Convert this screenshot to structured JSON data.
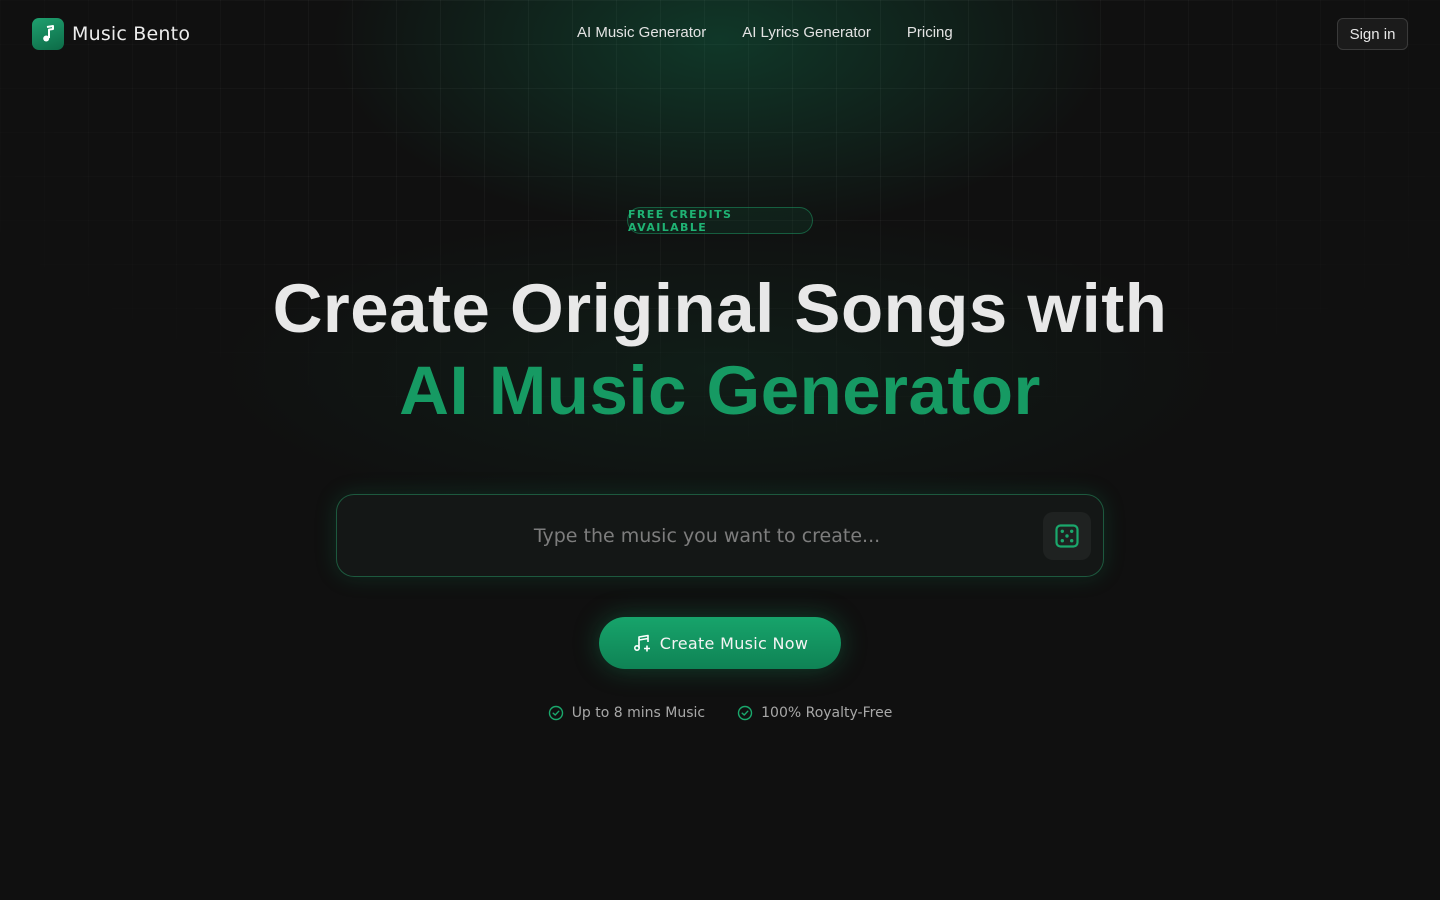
{
  "brand": {
    "name": "Music Bento",
    "logo_icon": "music-note-icon"
  },
  "nav": {
    "items": [
      {
        "label": "AI Music Generator"
      },
      {
        "label": "AI Lyrics Generator"
      },
      {
        "label": "Pricing"
      }
    ],
    "signin_label": "Sign in"
  },
  "hero": {
    "badge": "FREE CREDITS AVAILABLE",
    "title_line1": "Create Original Songs with",
    "title_line2": "AI Music Generator",
    "prompt": {
      "placeholder": "Type the music you want to create...",
      "value": "",
      "random_icon": "dice-icon"
    },
    "cta_label": "Create Music Now",
    "cta_icon": "music-note-plus-icon",
    "features": [
      {
        "label": "Up to 8 mins Music",
        "icon": "check-circle-icon"
      },
      {
        "label": "100% Royalty-Free",
        "icon": "check-circle-icon"
      }
    ]
  },
  "colors": {
    "accent": "#169a63",
    "background": "#101010",
    "text": "#e8e8e8"
  }
}
